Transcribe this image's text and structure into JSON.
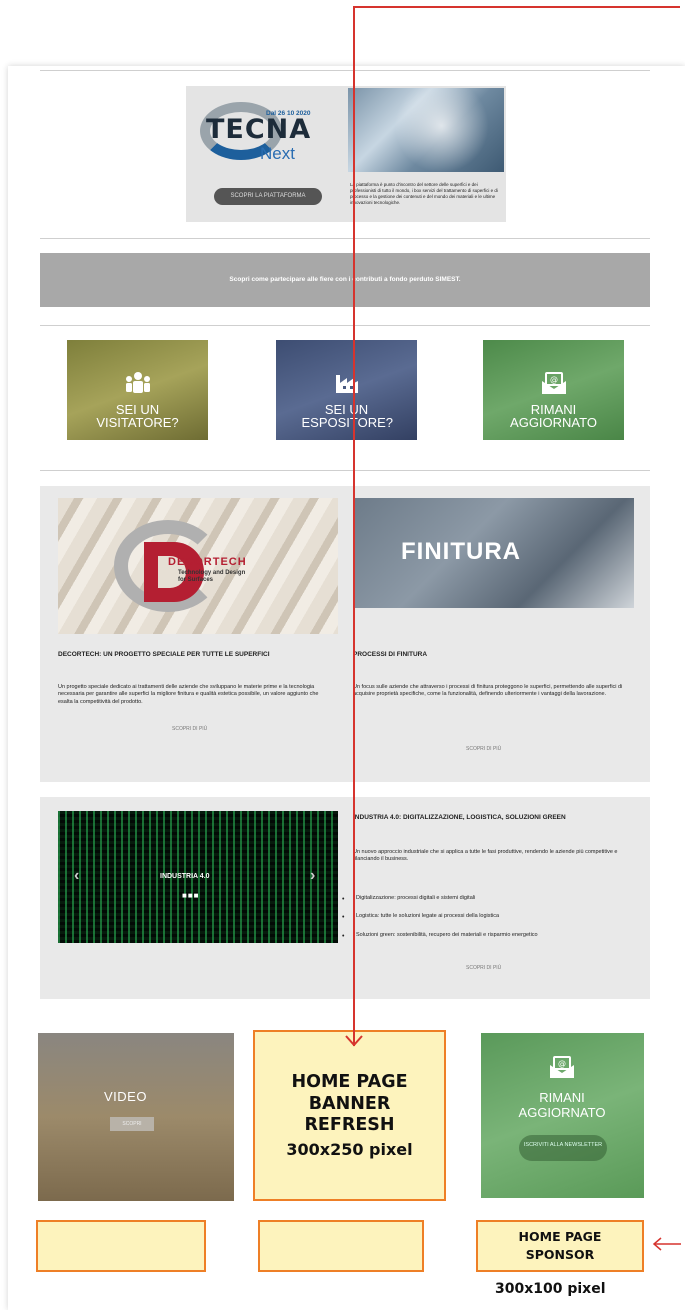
{
  "hero": {
    "logo_text": "TECNA",
    "logo_sub": "Next",
    "date": "Dal 26 10 2020",
    "button": "SCOPRI LA PIATTAFORMA",
    "desc": "La piattaforma è punto d'incontro del settore delle superfici e dei professionisti di tutto il mondo, i box servizi del trattamento di superfici e di processo e la gestione dei contenuti e del mondo dei materiali e le ultime innovazioni tecnologiche."
  },
  "simest_banner": "Scopri come partecipare alle fiere con i contributi a fondo perduto SIMEST.",
  "tiles": [
    {
      "label": "SEI UN VISITATORE?",
      "icon": "visitors-icon"
    },
    {
      "label": "SEI UN ESPOSITORE?",
      "icon": "factory-icon"
    },
    {
      "label": "RIMANI AGGIORNATO",
      "icon": "newsletter-icon"
    }
  ],
  "articles": [
    {
      "title": "DECORTECH: UN PROGETTO SPECIALE PER TUTTE LE SUPERFICI",
      "body": "Un progetto speciale dedicato ai trattamenti delle aziende che sviluppano le materie prime e la tecnologia necessaria per garantire alle superfici la migliore finitura e qualità estetica possibile, un valore aggiunto che esalta la competitività del prodotto.",
      "more": "SCOPRI DI PIÙ",
      "image_title": "DECORTECH",
      "image_sub": "Technology and Design for Surfaces"
    },
    {
      "title": "PROCESSI DI FINITURA",
      "body": "Un focus sulle aziende che attraverso i processi di finitura proteggono le superfici, permettendo alle superfici di acquisire proprietà specifiche, come la funzionalità, definendo ulteriormente i vantaggi della lavorazione.",
      "more": "SCOPRI DI PIÙ",
      "image_title": "FINITURA"
    }
  ],
  "industry": {
    "slider_label": "INDUSTRIA 4.0",
    "slider_dots": "■■■",
    "title": "INDUSTRIA 4.0: DIGITALIZZAZIONE, LOGISTICA, SOLUZIONI GREEN",
    "intro": "Un nuovo approccio industriale che si applica a tutte le fasi produttive, rendendo le aziende più competitive e rilanciando il business.",
    "bullets": [
      "Digitalizzazione: processi digitali e sistemi digitali",
      "Logistica: tutte le soluzioni legate ai processi della logistica",
      "Soluzioni green: sostenibilità, recupero dei materiali e risparmio energetico"
    ],
    "more": "SCOPRI DI PIÙ"
  },
  "video": {
    "label": "VIDEO",
    "button": "SCOPRI"
  },
  "stay_updated": {
    "label": "RIMANI AGGIORNATO",
    "button": "ISCRIVITI ALLA NEWSLETTER"
  },
  "ad_banner": {
    "line1": "HOME PAGE",
    "line2": "BANNER",
    "line3": "REFRESH",
    "size": "300x250 pixel"
  },
  "ad_sponsor": {
    "line1": "HOME PAGE",
    "line2": "SPONSOR",
    "size": "300x100 pixel"
  },
  "colors": {
    "annotation_red": "#d6342e",
    "ad_fill": "#fdf3bd",
    "ad_border": "#ee7f26"
  }
}
